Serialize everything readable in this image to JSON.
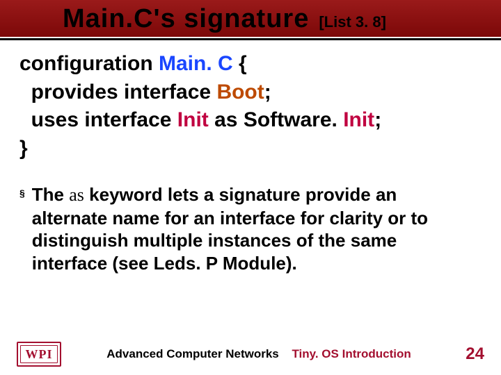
{
  "title": {
    "main": "Main.C's signature",
    "tag": "[List 3. 8]"
  },
  "code": {
    "l1_kw": "configuration ",
    "l1_id": "Main. C",
    "l1_end": " {",
    "l2_pre": "  provides interface ",
    "l2_id": "Boot",
    "l2_end": ";",
    "l3_pre": "  uses interface ",
    "l3_id": "Init",
    "l3_mid": " as Software. ",
    "l3_id2": "Init",
    "l3_end": ";",
    "l4": "}"
  },
  "note": {
    "pre": "The ",
    "kw": "as",
    "post": " keyword lets a signature provide an alternate name for an interface for clarity or to distinguish multiple instances of the same interface (see Leds. P Module)."
  },
  "footer": {
    "logo": "WPI",
    "course": "Advanced Computer Networks",
    "topic": "Tiny. OS Introduction",
    "page": "24"
  },
  "bullet_char": "§"
}
